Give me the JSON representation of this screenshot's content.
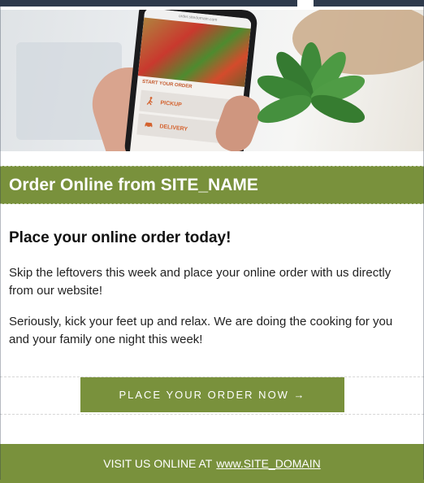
{
  "hero": {
    "phone_url": "order.sitedomain.com",
    "start_label": "START YOUR ORDER",
    "pickup_label": "PICKUP",
    "delivery_label": "DELIVERY",
    "icons": [
      "walking-person-icon",
      "car-icon",
      "plant",
      "food-photo"
    ]
  },
  "header": {
    "title": "Order Online from SITE_NAME"
  },
  "body": {
    "heading": "Place your online order today!",
    "paragraph1": "Skip the leftovers this week and place your online order with us directly from our website!",
    "paragraph2": "Seriously, kick your feet up and relax. We are doing the cooking for you and your family one night this week!"
  },
  "cta": {
    "label": "PLACE YOUR ORDER NOW →"
  },
  "footer": {
    "prefix": "VISIT US ONLINE AT",
    "link": "www.SITE_DOMAIN"
  },
  "colors": {
    "accent": "#79913c",
    "topbar": "#2e3a4c",
    "text": "#222222"
  }
}
